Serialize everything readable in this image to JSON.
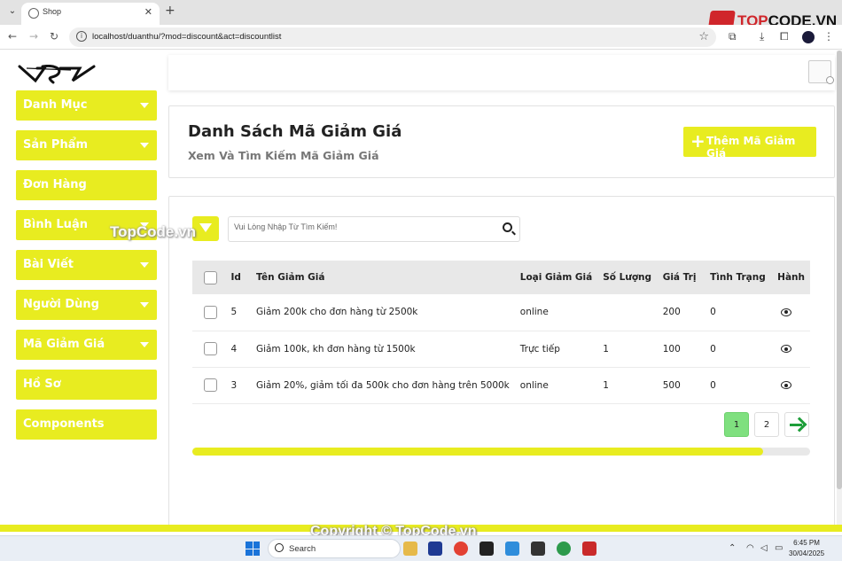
{
  "browser": {
    "tab_title": "Shop",
    "url": "localhost/duanthu/?mod=discount&act=discountlist"
  },
  "watermark": {
    "logo_text_a": "TOP",
    "logo_text_b": "CODE.VN",
    "text_mid": "TopCode.vn",
    "text_bottom": "Copyright © TopCode.vn"
  },
  "sidebar": {
    "items": [
      {
        "label": "Danh Mục",
        "has_caret": true
      },
      {
        "label": "Sản Phẩm",
        "has_caret": true
      },
      {
        "label": "Đơn Hàng",
        "has_caret": false
      },
      {
        "label": "Bình Luận",
        "has_caret": true
      },
      {
        "label": "Bài Viết",
        "has_caret": true
      },
      {
        "label": "Người Dùng",
        "has_caret": true
      },
      {
        "label": "Mã Giảm Giá",
        "has_caret": true
      },
      {
        "label": "Hồ Sơ",
        "has_caret": false
      },
      {
        "label": "Components",
        "has_caret": false
      }
    ]
  },
  "header": {
    "title": "Danh Sách Mã Giảm Giá",
    "subtitle": "Xem Và Tìm Kiếm Mã Giảm Giá",
    "add_button": "Thêm Mã Giảm Giá"
  },
  "search": {
    "placeholder": "Vui Lòng Nhập Từ Tìm Kiếm!"
  },
  "table": {
    "headers": [
      "Id",
      "Tên Giảm Giá",
      "Loại Giảm Giá",
      "Số Lượng",
      "Giá Trị",
      "Tình Trạng",
      "Hành"
    ],
    "rows": [
      {
        "id": "5",
        "name": "Giảm 200k cho đơn hàng từ 2500k",
        "type": "online",
        "qty": "",
        "value": "200",
        "status": "0"
      },
      {
        "id": "4",
        "name": "Giảm 100k, kh đơn hàng từ 1500k",
        "type": "Trực tiếp",
        "qty": "1",
        "value": "100",
        "status": "0"
      },
      {
        "id": "3",
        "name": "Giảm 20%, giảm tối đa 500k cho đơn hàng trên 5000k",
        "type": "online",
        "qty": "1",
        "value": "500",
        "status": "0"
      }
    ]
  },
  "pagination": {
    "pages": [
      "1",
      "2"
    ],
    "active": "1"
  },
  "taskbar": {
    "search_label": "Search",
    "time": "6:45 PM",
    "date": "30/04/2025"
  },
  "colors": {
    "accent": "#e8ec20",
    "active_page": "#7fe07f",
    "next_arrow": "#1e9e3a"
  }
}
